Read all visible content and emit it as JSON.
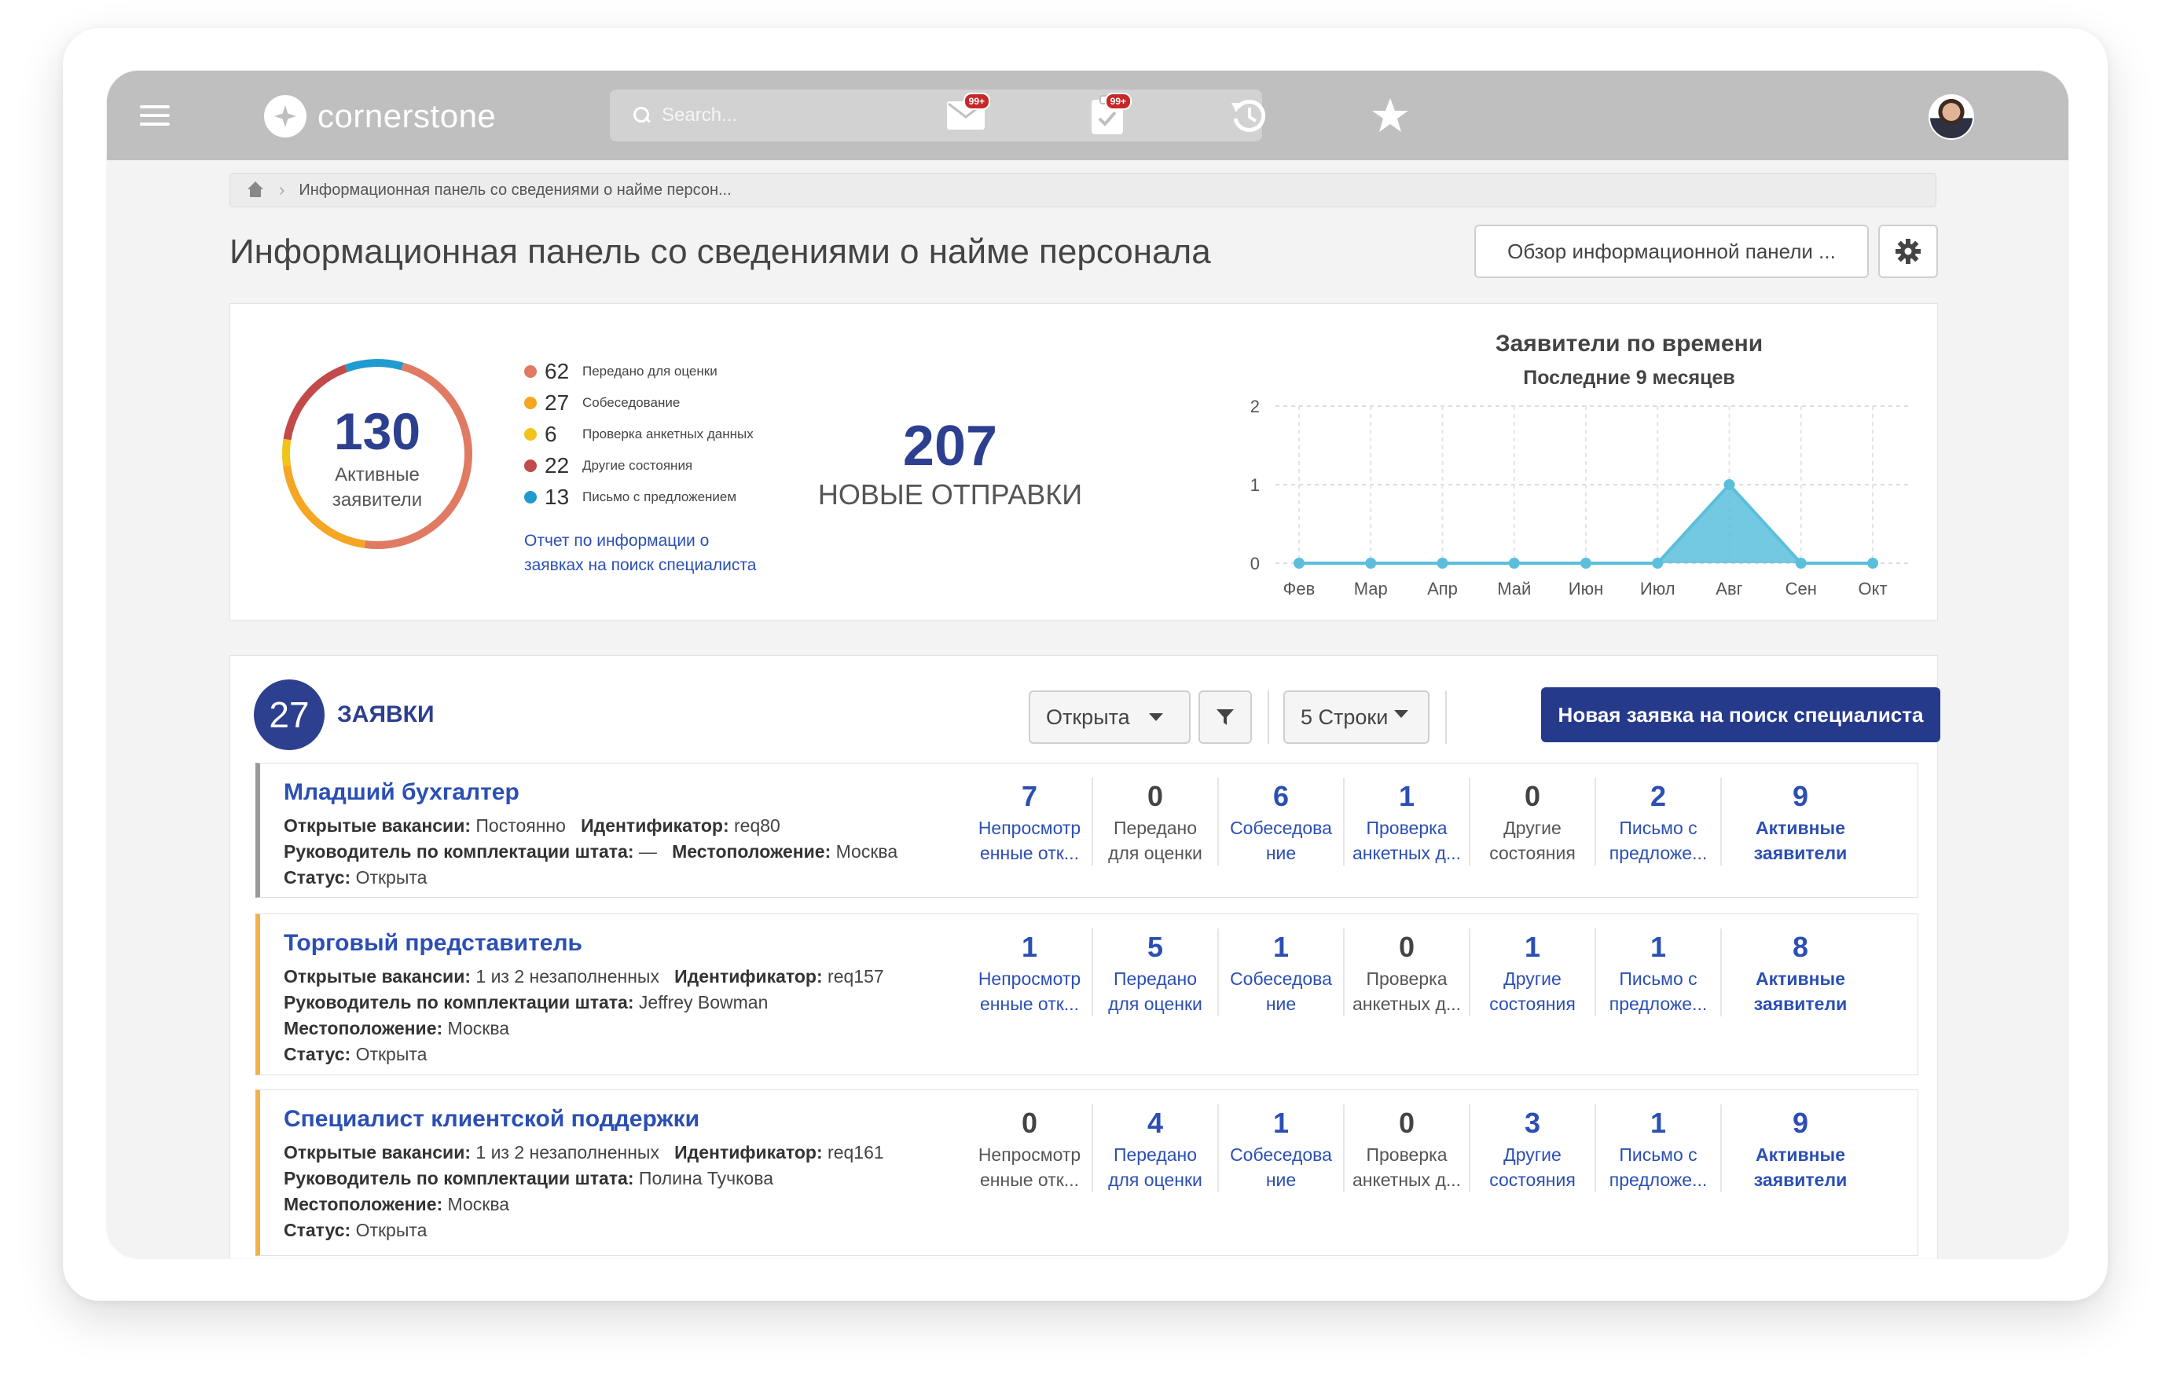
{
  "app": {
    "logo_text": "cornerstone"
  },
  "header": {
    "search_placeholder": "Search...",
    "mail_badge": "99+",
    "tasks_badge": "99+"
  },
  "breadcrumb": {
    "current": "Информационная панель со сведениями о найме персон..."
  },
  "page": {
    "title": "Информационная панель со сведениями о найме персонала",
    "overview_button": "Обзор информационной панели ..."
  },
  "summary": {
    "active_count": "130",
    "active_label_line1": "Активные",
    "active_label_line2": "заявители",
    "legend": [
      {
        "value": "62",
        "label": "Передано для оценки",
        "color": "#e07a63"
      },
      {
        "value": "27",
        "label": "Собеседование",
        "color": "#f5a623"
      },
      {
        "value": "6",
        "label": "Проверка анкетных данных",
        "color": "#f0c419"
      },
      {
        "value": "22",
        "label": "Другие состояния",
        "color": "#c24a4a"
      },
      {
        "value": "13",
        "label": "Письмо с предложением",
        "color": "#1f9bd1"
      }
    ],
    "report_link_line1": "Отчет по информации о",
    "report_link_line2": "заявках на поиск специалиста",
    "new_submissions_count": "207",
    "new_submissions_label": "НОВЫЕ ОТПРАВКИ"
  },
  "chart_data": {
    "type": "area",
    "title": "Заявители по времени",
    "subtitle": "Последние 9 месяцев",
    "categories": [
      "Фев",
      "Мар",
      "Апр",
      "Май",
      "Июн",
      "Июл",
      "Авг",
      "Сен",
      "Окт"
    ],
    "values": [
      0,
      0,
      0,
      0,
      0,
      0,
      1,
      0,
      0
    ],
    "ylim": [
      0,
      2
    ],
    "yticks": [
      "0",
      "1",
      "2"
    ],
    "grid": true,
    "color": "#5bbfdc"
  },
  "requisitions": {
    "count": "27",
    "title": "ЗАЯВКИ",
    "status_filter": "Открыта",
    "rows_selector": "5 Строки",
    "new_button": "Новая заявка на поиск специалиста",
    "labels": {
      "openings": "Открытые вакансии:",
      "id": "Идентификатор:",
      "manager": "Руководитель по комплектации штата:",
      "location": "Местоположение:",
      "status": "Статус:"
    },
    "items": [
      {
        "title": "Младший бухгалтер",
        "openings": "Постоянно",
        "id": "req80",
        "manager": "—",
        "location": "Москва",
        "status": "Открыта",
        "stats": [
          {
            "value": "7",
            "l1": "Непросмотр",
            "l2": "енные отк..."
          },
          {
            "value": "0",
            "l1": "Передано",
            "l2": "для оценки"
          },
          {
            "value": "6",
            "l1": "Собеседова",
            "l2": "ние"
          },
          {
            "value": "1",
            "l1": "Проверка",
            "l2": "анкетных д..."
          },
          {
            "value": "0",
            "l1": "Другие",
            "l2": "состояния"
          },
          {
            "value": "2",
            "l1": "Письмо с",
            "l2": "предложе..."
          },
          {
            "value": "9",
            "l1": "Активные",
            "l2": "заявители"
          }
        ]
      },
      {
        "title": "Торговый представитель",
        "openings": "1 из 2 незаполненных",
        "id": "req157",
        "manager": "Jeffrey Bowman",
        "location": "Москва",
        "status": "Открыта",
        "stats": [
          {
            "value": "1",
            "l1": "Непросмотр",
            "l2": "енные отк..."
          },
          {
            "value": "5",
            "l1": "Передано",
            "l2": "для оценки"
          },
          {
            "value": "1",
            "l1": "Собеседова",
            "l2": "ние"
          },
          {
            "value": "0",
            "l1": "Проверка",
            "l2": "анкетных д..."
          },
          {
            "value": "1",
            "l1": "Другие",
            "l2": "состояния"
          },
          {
            "value": "1",
            "l1": "Письмо с",
            "l2": "предложе..."
          },
          {
            "value": "8",
            "l1": "Активные",
            "l2": "заявители"
          }
        ]
      },
      {
        "title": "Специалист клиентской поддержки",
        "openings": "1 из 2 незаполненных",
        "id": "req161",
        "manager": "Полина Тучкова",
        "location": "Москва",
        "status": "Открыта",
        "stats": [
          {
            "value": "0",
            "l1": "Непросмотр",
            "l2": "енные отк..."
          },
          {
            "value": "4",
            "l1": "Передано",
            "l2": "для оценки"
          },
          {
            "value": "1",
            "l1": "Собеседова",
            "l2": "ние"
          },
          {
            "value": "0",
            "l1": "Проверка",
            "l2": "анкетных д..."
          },
          {
            "value": "3",
            "l1": "Другие",
            "l2": "состояния"
          },
          {
            "value": "1",
            "l1": "Письмо с",
            "l2": "предложе..."
          },
          {
            "value": "9",
            "l1": "Активные",
            "l2": "заявители"
          }
        ]
      }
    ]
  },
  "icons": {
    "menu": "hamburger-icon",
    "search": "search-icon",
    "mail": "envelope-icon",
    "tasks": "clipboard-check-icon",
    "history": "history-icon",
    "favorites": "star-icon",
    "home": "home-icon",
    "settings": "gear-icon",
    "filter": "filter-icon"
  }
}
